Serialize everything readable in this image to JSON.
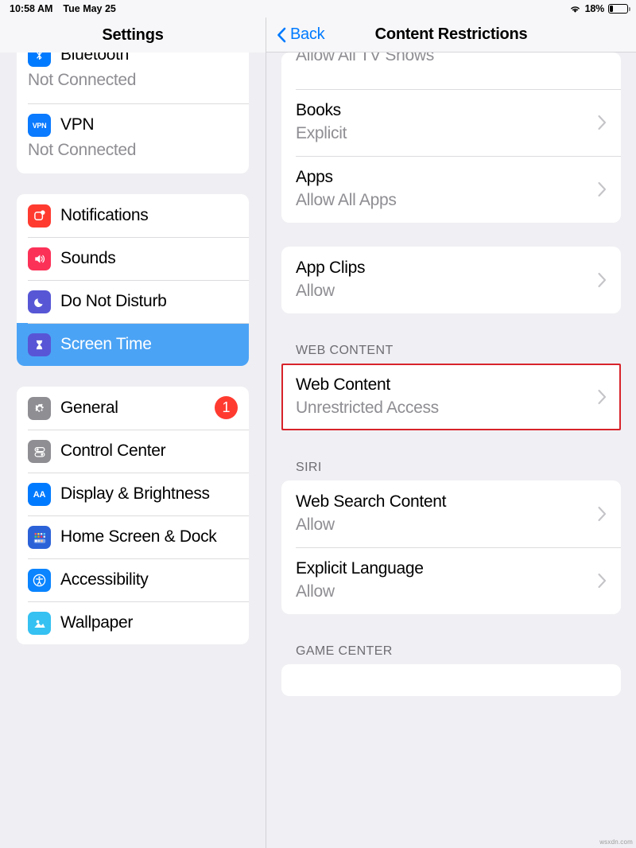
{
  "status_bar": {
    "time": "10:58 AM",
    "date": "Tue May 25",
    "wifi_icon": "wifi-icon",
    "battery_percent": "18%",
    "battery_level": 18,
    "battery_icon": "battery-icon"
  },
  "sidebar": {
    "title": "Settings",
    "groups": [
      {
        "name": "connectivity",
        "items": [
          {
            "label": "Bluetooth",
            "sub": "Not Connected",
            "icon": "bluetooth-icon",
            "icon_color": "#007AFF",
            "clipped": true
          },
          {
            "label": "VPN",
            "sub": "Not Connected",
            "icon": "vpn-icon",
            "icon_color": "#0A7AFF",
            "clipped": false
          }
        ]
      },
      {
        "name": "alerts",
        "items": [
          {
            "label": "Notifications",
            "icon": "notifications-icon",
            "icon_color": "#FF3B30",
            "selected": false
          },
          {
            "label": "Sounds",
            "icon": "sounds-icon",
            "icon_color": "#FC3158",
            "selected": false
          },
          {
            "label": "Do Not Disturb",
            "icon": "moon-icon",
            "icon_color": "#5757D6",
            "selected": false
          },
          {
            "label": "Screen Time",
            "icon": "hourglass-icon",
            "icon_color": "#5856D6",
            "selected": true
          }
        ]
      },
      {
        "name": "system",
        "items": [
          {
            "label": "General",
            "icon": "gear-icon",
            "icon_color": "#8E8E93",
            "badge": "1"
          },
          {
            "label": "Control Center",
            "icon": "control-center-icon",
            "icon_color": "#8E8E93"
          },
          {
            "label": "Display & Brightness",
            "icon": "display-brightness-icon",
            "icon_color": "#007AFF"
          },
          {
            "label": "Home Screen & Dock",
            "icon": "home-screen-dock-icon",
            "icon_color": "#2C62D8"
          },
          {
            "label": "Accessibility",
            "icon": "accessibility-icon",
            "icon_color": "#0A84FF"
          },
          {
            "label": "Wallpaper",
            "icon": "wallpaper-icon",
            "icon_color": "#35C1F1",
            "clipped_bottom": true
          }
        ]
      }
    ],
    "selected_item": "Screen Time",
    "selected_color": "#4BA3F5",
    "badge_color": "#FF3B30"
  },
  "detail": {
    "back_label": "Back",
    "title": "Content Restrictions",
    "clipped_top_row": "Allow All TV Shows",
    "groups": [
      {
        "name": "ratings-group",
        "header": "",
        "rows": [
          {
            "title": "Books",
            "sub": "Explicit",
            "chevron": "chevron-right-icon"
          },
          {
            "title": "Apps",
            "sub": "Allow All Apps",
            "chevron": "chevron-right-icon"
          }
        ]
      },
      {
        "name": "app-clips-group",
        "header": "",
        "rows": [
          {
            "title": "App Clips",
            "sub": "Allow",
            "chevron": "chevron-right-icon"
          }
        ]
      },
      {
        "name": "web-content-group",
        "header": "WEB CONTENT",
        "rows": [
          {
            "title": "Web Content",
            "sub": "Unrestricted Access",
            "chevron": "chevron-right-icon",
            "highlighted": true
          }
        ]
      },
      {
        "name": "siri-group",
        "header": "SIRI",
        "rows": [
          {
            "title": "Web Search Content",
            "sub": "Allow",
            "chevron": "chevron-right-icon"
          },
          {
            "title": "Explicit Language",
            "sub": "Allow",
            "chevron": "chevron-right-icon"
          }
        ]
      },
      {
        "name": "game-center-group",
        "header": "GAME CENTER",
        "rows": []
      }
    ]
  },
  "annotation": {
    "color": "#D8232A",
    "target": "Web Content"
  },
  "watermark": "wsxdn.com"
}
